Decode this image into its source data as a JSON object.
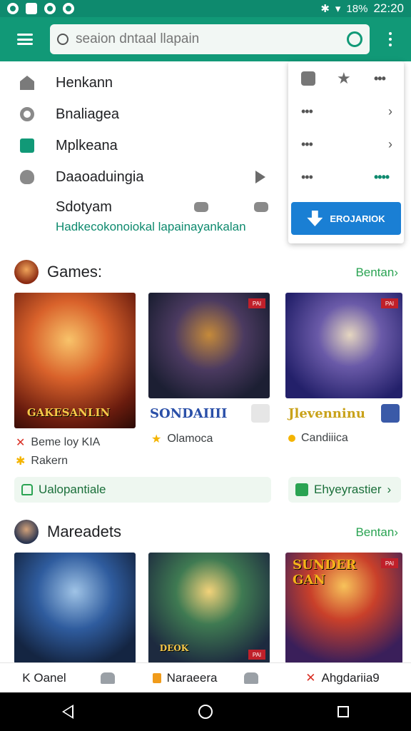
{
  "status_bar": {
    "battery": "18%",
    "time": "22:20"
  },
  "search": {
    "placeholder": "seaion dntaal llapain"
  },
  "drawer": {
    "items": [
      {
        "label": "Henkann",
        "icon": "home-icon"
      },
      {
        "label": "Bnaliagea",
        "icon": "radio-icon"
      },
      {
        "label": "Mplkeana",
        "icon": "check-icon"
      },
      {
        "label": "Daaoaduingia",
        "icon": "person-icon"
      },
      {
        "label": "Sdotyam",
        "icon": "tools-icon"
      }
    ],
    "link_text": "Hadkecokonoiokal lapainayankalan"
  },
  "popup": {
    "button_label": "EROJARIOK"
  },
  "sections": [
    {
      "title": "Games:",
      "more_label": "Bentan",
      "cards": [
        {
          "banner": "GAKESANLIN",
          "corner": ""
        },
        {
          "banner": "",
          "corner": "PAI"
        },
        {
          "banner": "",
          "corner": "PAI"
        }
      ],
      "titles": [
        "SONDAIIII",
        "Jlevenninu"
      ],
      "meta": [
        {
          "line1": "Beme loy KIA",
          "line2": "Rakern"
        },
        {
          "line1": "Olamoca"
        },
        {
          "line1": "Candiiica"
        }
      ],
      "chips": [
        "Ualopantiale",
        "Ehyeyrastier"
      ]
    },
    {
      "title": "Mareadets",
      "more_label": "Bentan",
      "cards": [
        {
          "banner": "",
          "corner": ""
        },
        {
          "banner": "DEOK",
          "corner": "PAI"
        },
        {
          "banner": "SUNDER GAN",
          "corner": "PAI"
        }
      ]
    }
  ],
  "tabs": [
    {
      "label": "K Oanel"
    },
    {
      "label": "Naraeera"
    },
    {
      "label": "Ahgdariia9"
    }
  ],
  "colors": {
    "primary": "#119977",
    "accent": "#2aa352",
    "button_blue": "#1a7fd4"
  }
}
